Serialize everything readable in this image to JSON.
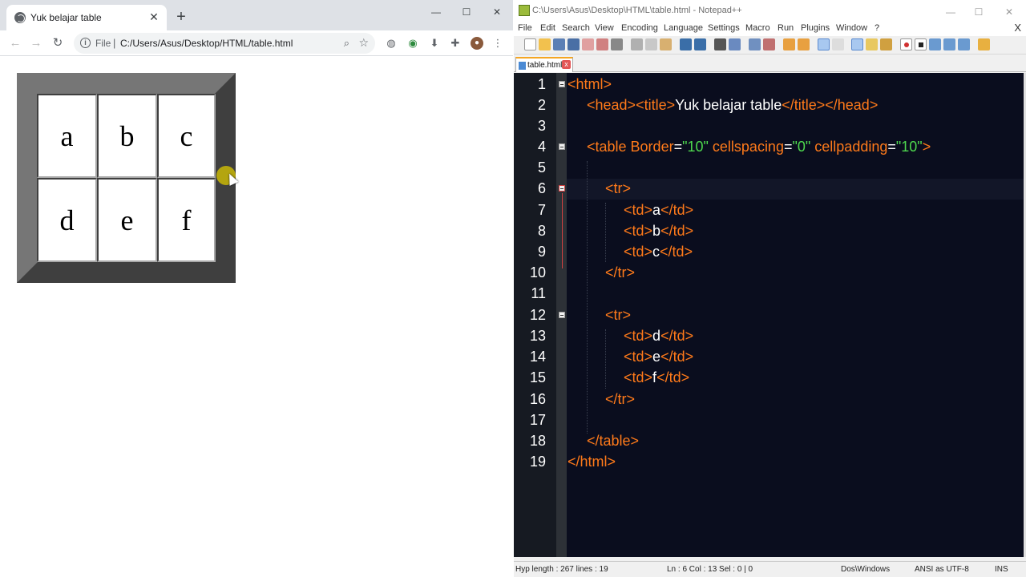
{
  "browser": {
    "tab_title": "Yuk belajar table",
    "tab_close": "✕",
    "new_tab": "+",
    "window_controls": {
      "minimize": "—",
      "maximize": "☐",
      "close": "✕"
    },
    "nav": {
      "back": "←",
      "forward": "→",
      "reload": "↻"
    },
    "omnibox": {
      "info": "i",
      "scheme": "File",
      "separator": "|",
      "url": "C:/Users/Asus/Desktop/HTML/table.html"
    },
    "icons": [
      "zoom-icon",
      "star-icon",
      "globe-icon",
      "extension-color-icon",
      "download-icon",
      "puzzle-icon",
      "avatar",
      "menu-kebab-icon"
    ],
    "page": {
      "table_rows": [
        [
          "a",
          "b",
          "c"
        ],
        [
          "d",
          "e",
          "f"
        ]
      ]
    }
  },
  "notepad": {
    "window_title": "C:\\Users\\Asus\\Desktop\\HTML\\table.html - Notepad++",
    "menus": [
      "File",
      "Edit",
      "Search",
      "View",
      "Encoding",
      "Language",
      "Settings",
      "Macro",
      "Run",
      "Plugins",
      "Window",
      "?"
    ],
    "menu_close": "X",
    "tab": {
      "label": "table.html",
      "close": "x"
    },
    "line_numbers": [
      "1",
      "2",
      "3",
      "4",
      "5",
      "6",
      "7",
      "8",
      "9",
      "10",
      "11",
      "12",
      "13",
      "14",
      "15",
      "16",
      "17",
      "18",
      "19"
    ],
    "code": {
      "l1_open": "<html>",
      "l2_head_open": "<head>",
      "l2_title_open": "<title>",
      "l2_title_text": "Yuk belajar table",
      "l2_title_close": "</title>",
      "l2_head_close": "</head>",
      "l4_table": "<table Border",
      "l4_eq1": "=",
      "l4_v1": "\"10\"",
      "l4_a2": " cellspacing",
      "l4_eq2": "=",
      "l4_v2": "\"0\"",
      "l4_a3": " cellpadding",
      "l4_eq3": "=",
      "l4_v3": "\"10\"",
      "l4_close": ">",
      "tr_open": "<tr>",
      "tr_close": "</tr>",
      "td_open": "<td>",
      "td_close": "</td>",
      "cells": [
        "a",
        "b",
        "c",
        "d",
        "e",
        "f"
      ],
      "table_close": "</table>",
      "html_close": "</html>"
    },
    "status": {
      "hyp": "Hyp  length : 267    lines : 19",
      "pos": "Ln : 6    Col : 13    Sel : 0 | 0",
      "eol": "Dos\\Windows",
      "encoding": "ANSI as UTF-8",
      "mode": "INS"
    },
    "colors": {
      "background": "#0a0d1e",
      "tag": "#ff7a1a",
      "string": "#4ed84e",
      "text": "#ffffff"
    }
  }
}
